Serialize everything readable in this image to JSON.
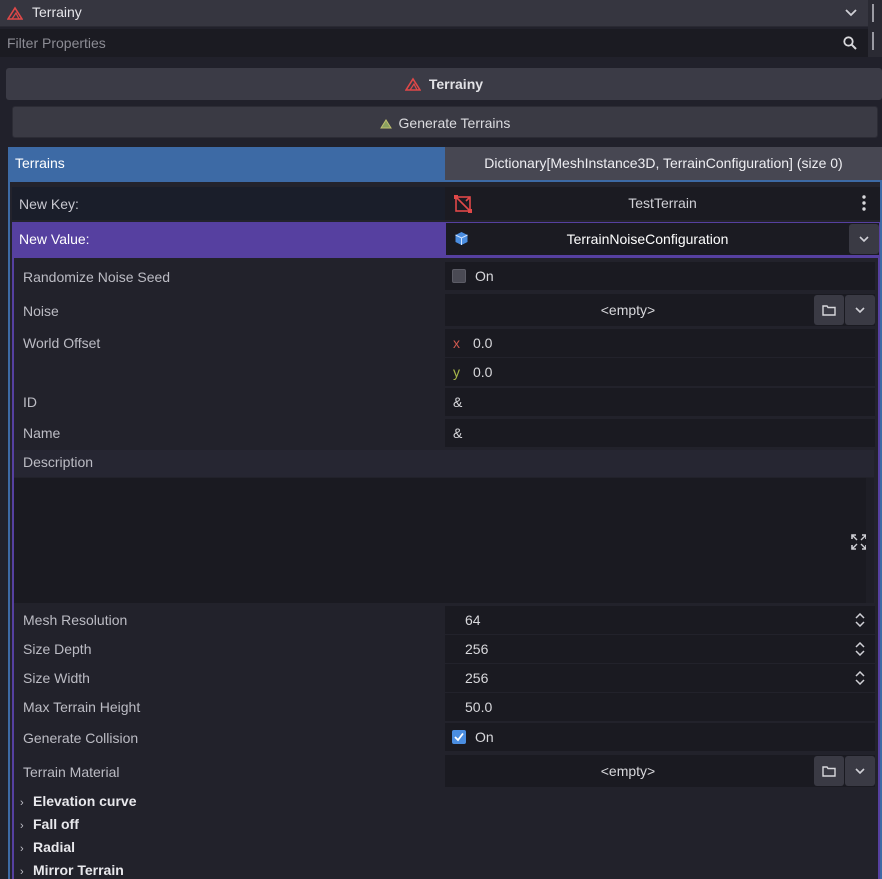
{
  "header": {
    "node_name": "Terrainy",
    "filter_placeholder": "Filter Properties"
  },
  "section_title": "Terrainy",
  "generate_button": "Generate Terrains",
  "terrains": {
    "label": "Terrains",
    "value": "Dictionary[MeshInstance3D, TerrainConfiguration] (size 0)"
  },
  "new_key": {
    "label": "New Key:",
    "value": "TestTerrain"
  },
  "new_value": {
    "label": "New Value:",
    "value": "TerrainNoiseConfiguration"
  },
  "properties": {
    "randomize_noise_seed": {
      "label": "Randomize Noise Seed",
      "value": "On",
      "checked": false
    },
    "noise": {
      "label": "Noise",
      "value": "<empty>"
    },
    "world_offset": {
      "label": "World Offset",
      "x_label": "x",
      "x": "0.0",
      "y_label": "y",
      "y": "0.0"
    },
    "id": {
      "label": "ID",
      "value": "&"
    },
    "name": {
      "label": "Name",
      "value": "&"
    },
    "description": {
      "label": "Description"
    },
    "mesh_resolution": {
      "label": "Mesh Resolution",
      "value": "64"
    },
    "size_depth": {
      "label": "Size Depth",
      "value": "256"
    },
    "size_width": {
      "label": "Size Width",
      "value": "256"
    },
    "max_terrain_height": {
      "label": "Max Terrain Height",
      "value": "50.0"
    },
    "generate_collision": {
      "label": "Generate Collision",
      "value": "On",
      "checked": true
    },
    "terrain_material": {
      "label": "Terrain Material",
      "value": "<empty>"
    }
  },
  "sections": [
    "Elevation curve",
    "Fall off",
    "Radial",
    "Mirror Terrain"
  ],
  "colors": {
    "terrains_accent": "#3d6aa5",
    "new_value_accent": "#5640a0",
    "checkbox_checked": "#4a8de0",
    "terrain_icon": "#e04848"
  }
}
